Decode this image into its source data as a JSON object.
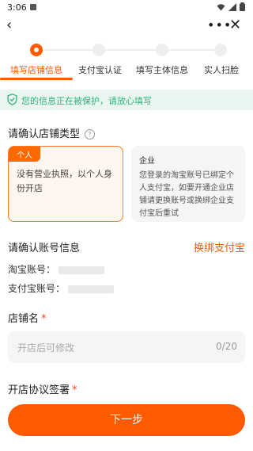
{
  "status_bar": {
    "time": "3:06"
  },
  "nav": {
    "back_icon": "‹",
    "more_icon": "•••",
    "close_icon": "✕"
  },
  "steps": [
    {
      "label": "填写店铺信息",
      "active": true
    },
    {
      "label": "支付宝认证",
      "active": false
    },
    {
      "label": "填写主体信息",
      "active": false
    },
    {
      "label": "实人扫脸",
      "active": false
    }
  ],
  "protect_banner": {
    "text": "您的信息正在被保护，请放心填写"
  },
  "shop_type": {
    "title": "请确认店铺类型",
    "help_icon": "?",
    "personal": {
      "tag": "个人",
      "desc": "没有营业执照，以个人身份开店"
    },
    "enterprise": {
      "title": "企业",
      "desc": "您登录的淘宝账号已绑定个人支付宝，如要开通企业店铺请更换账号或换绑企业支付宝后重试"
    }
  },
  "account": {
    "title": "请确认账号信息",
    "rebind_label": "换绑支付宝",
    "taobao_label": "淘宝账号：",
    "alipay_label": "支付宝账号："
  },
  "shop_name": {
    "title": "店铺名",
    "required_mark": "*",
    "placeholder": "开店后可修改",
    "counter": "0/20"
  },
  "agreement": {
    "title": "开店协议签署",
    "required_mark": "*"
  },
  "next_button": {
    "label": "下一步"
  },
  "colors": {
    "accent": "#ff5a00",
    "safe_green": "#2db37a"
  }
}
